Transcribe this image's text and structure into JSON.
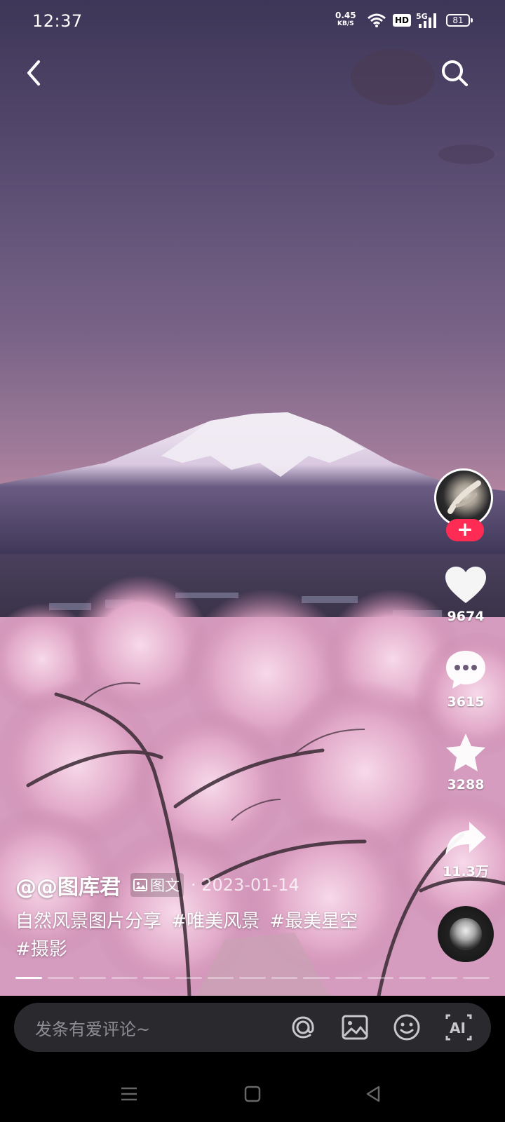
{
  "status_bar": {
    "time": "12:37",
    "net_speed": "0.45",
    "net_unit": "KB/S",
    "hd": "HD",
    "network": "5G",
    "battery": "81"
  },
  "post": {
    "author": "@@图库君",
    "type_label": "图文",
    "date": "· 2023-01-14",
    "description": "自然风景图片分享",
    "hashtags": [
      "#唯美风景",
      "#最美星空",
      "#摄影"
    ],
    "image_count": 15,
    "current_image": 1
  },
  "actions": {
    "follow": "+",
    "likes": "9674",
    "comments": "3615",
    "favorites": "3288",
    "shares": "11.3万"
  },
  "comment_bar": {
    "placeholder": "发条有爱评论~"
  },
  "icons": {
    "back": "chevron-left-icon",
    "search": "search-icon",
    "like": "heart-icon",
    "comment": "comment-bubble-icon",
    "favorite": "star-icon",
    "share": "share-arrow-icon",
    "mention": "at-icon",
    "image": "image-icon",
    "emoji": "emoji-icon",
    "ai": "ai-icon"
  },
  "colors": {
    "follow": "#fe2c55",
    "comment_bar": "#2a2a2e"
  }
}
